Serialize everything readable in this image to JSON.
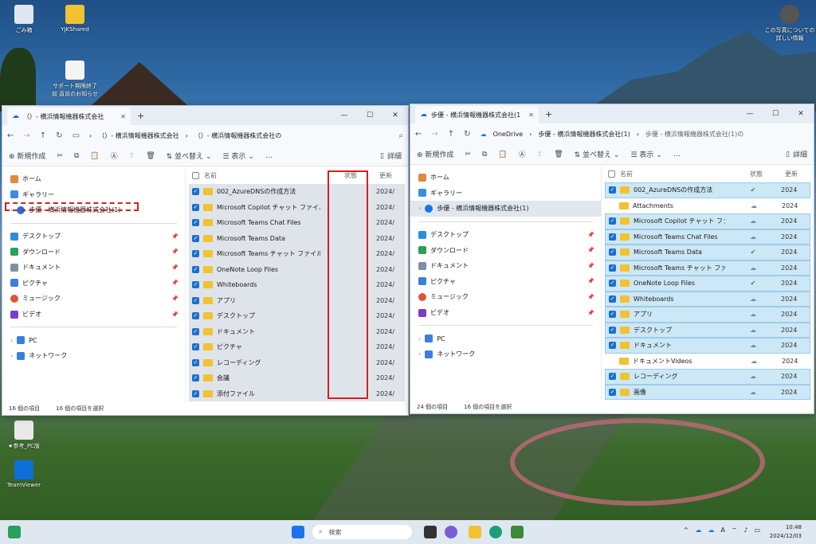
{
  "desktop": {
    "icons": [
      {
        "label": "ごみ箱"
      },
      {
        "label": "YJKShared"
      },
      {
        "label": "サポート期限終了前 直前のお知らせ"
      },
      {
        "label": "★参考_PC版"
      },
      {
        "label": "TeamViewer"
      },
      {
        "label": "この写真についての詳しい情報"
      }
    ]
  },
  "left": {
    "tab_title": "（）- 横浜情報機器株式会社",
    "crumbs": [
      "（）- 横浜情報機器株式会社",
      "（）- 横浜情報機器株式会社の"
    ],
    "toolbar": {
      "new": "新規作成",
      "sort": "並べ替え",
      "view": "表示",
      "more": "…",
      "details": "詳細"
    },
    "nav": [
      {
        "label": "ホーム",
        "color": "#e08a3c"
      },
      {
        "label": "ギャラリー",
        "color": "#3c8de0"
      },
      {
        "label": "歩優 - 横浜情報機器株式会社(1)",
        "color": "#1a73e8",
        "chev": "›"
      }
    ],
    "quick": [
      {
        "label": "デスクトップ",
        "color": "#2b90d9"
      },
      {
        "label": "ダウンロード",
        "color": "#2aa05a"
      },
      {
        "label": "ドキュメント",
        "color": "#7b8fa6"
      },
      {
        "label": "ピクチャ",
        "color": "#3c7fd8"
      },
      {
        "label": "ミュージック",
        "color": "#e0543c"
      },
      {
        "label": "ビデオ",
        "color": "#7a3cc8"
      }
    ],
    "bottom": [
      {
        "label": "PC",
        "color": "#3c7fd8"
      },
      {
        "label": "ネットワーク",
        "color": "#3c7fd8"
      }
    ],
    "cols": {
      "name": "名前",
      "status": "状態",
      "date": "更新"
    },
    "rows": [
      {
        "name": "002_AzureDNSの作成方法",
        "date": "2024/"
      },
      {
        "name": "Microsoft Copilot チャット ファイル",
        "date": "2024/"
      },
      {
        "name": "Microsoft Teams Chat Files",
        "date": "2024/"
      },
      {
        "name": "Microsoft Teams Data",
        "date": "2024/"
      },
      {
        "name": "Microsoft Teams チャット ファイル",
        "date": "2024/"
      },
      {
        "name": "OneNote Loop Files",
        "date": "2024/"
      },
      {
        "name": "Whiteboards",
        "date": "2024/"
      },
      {
        "name": "アプリ",
        "date": "2024/"
      },
      {
        "name": "デスクトップ",
        "date": "2024/"
      },
      {
        "name": "ドキュメント",
        "date": "2024/"
      },
      {
        "name": "ピクチャ",
        "date": "2024/"
      },
      {
        "name": "レコーディング",
        "date": "2024/"
      },
      {
        "name": "会議",
        "date": "2024/"
      },
      {
        "name": "添付ファイル",
        "date": "2024/"
      }
    ],
    "status_items": "16 個の項目",
    "status_sel": "16 個の項目を選択"
  },
  "right": {
    "tab_title": "歩優 - 横浜情報機器株式会社(1",
    "crumbs": [
      "OneDrive",
      "歩優 - 横浜情報機器株式会社(1)",
      "歩優 - 横浜情報機器株式会社(1)の"
    ],
    "toolbar": {
      "new": "新規作成",
      "sort": "並べ替え",
      "view": "表示",
      "more": "…",
      "details": "詳細"
    },
    "nav": [
      {
        "label": "ホーム"
      },
      {
        "label": "ギャラリー"
      },
      {
        "label": "歩優 - 横浜情報機器株式会社(1)"
      }
    ],
    "quick": [
      {
        "label": "デスクトップ"
      },
      {
        "label": "ダウンロード"
      },
      {
        "label": "ドキュメント"
      },
      {
        "label": "ピクチャ"
      },
      {
        "label": "ミュージック"
      },
      {
        "label": "ビデオ"
      }
    ],
    "bottom": [
      {
        "label": "PC"
      },
      {
        "label": "ネットワーク"
      }
    ],
    "cols": {
      "name": "名前",
      "status": "状態",
      "date": "更新"
    },
    "rows": [
      {
        "name": "002_AzureDNSの作成方法",
        "st": "✔",
        "date": "2024",
        "sel": true
      },
      {
        "name": "Attachments",
        "st": "☁",
        "date": "2024",
        "sel": false
      },
      {
        "name": "Microsoft Copilot チャット ファイル",
        "st": "☁",
        "date": "2024",
        "sel": true
      },
      {
        "name": "Microsoft Teams Chat Files",
        "st": "☁",
        "date": "2024",
        "sel": true
      },
      {
        "name": "Microsoft Teams Data",
        "st": "✔",
        "date": "2024",
        "sel": true
      },
      {
        "name": "Microsoft Teams チャット ファイル",
        "st": "☁",
        "date": "2024",
        "sel": true
      },
      {
        "name": "OneNote Loop Files",
        "st": "✔",
        "date": "2024",
        "sel": true
      },
      {
        "name": "Whiteboards",
        "st": "☁",
        "date": "2024",
        "sel": true
      },
      {
        "name": "アプリ",
        "st": "☁",
        "date": "2024",
        "sel": true
      },
      {
        "name": "デスクトップ",
        "st": "☁",
        "date": "2024",
        "sel": true
      },
      {
        "name": "ドキュメント",
        "st": "☁",
        "date": "2024",
        "sel": true
      },
      {
        "name": "ドキュメントVideos",
        "st": "☁",
        "date": "2024",
        "sel": false
      },
      {
        "name": "レコーディング",
        "st": "☁",
        "date": "2024",
        "sel": true
      },
      {
        "name": "画像",
        "st": "☁",
        "date": "2024",
        "sel": true
      }
    ],
    "status_items": "24 個の項目",
    "status_sel": "16 個の項目を選択"
  },
  "taskbar": {
    "search": "検索",
    "time": "10:48",
    "date": "2024/12/03"
  }
}
